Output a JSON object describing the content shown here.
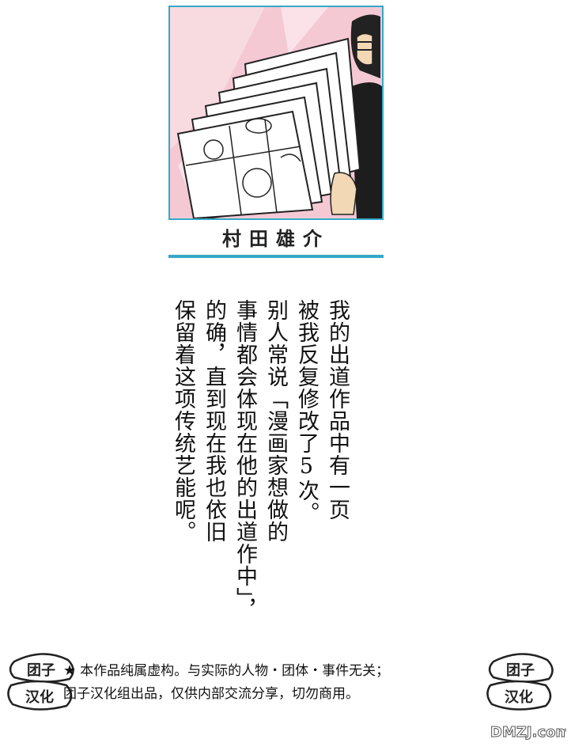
{
  "author": {
    "name": "村田雄介"
  },
  "comment": {
    "lines": [
      "我的出道作品中有一页",
      "被我反复修改了5次。",
      "别人常说「漫画家想做的",
      "事情都会体现在他的出道作中」，",
      "的确，直到现在我也依旧",
      "保留着这项传统艺能呢。"
    ]
  },
  "disclaimer": {
    "star": "★",
    "line1": "本作品纯属虚构。与实际的人物・团体・事件无关；",
    "line2": "团子汉化组出品，仅供内部交流分享，切勿商用。"
  },
  "logo": {
    "text_top": "团子",
    "text_bottom": "汉化"
  },
  "watermark": {
    "text": "DMZJ.com"
  },
  "colors": {
    "accent": "#35a8c9",
    "portrait_bg": "#f4c9d3"
  }
}
